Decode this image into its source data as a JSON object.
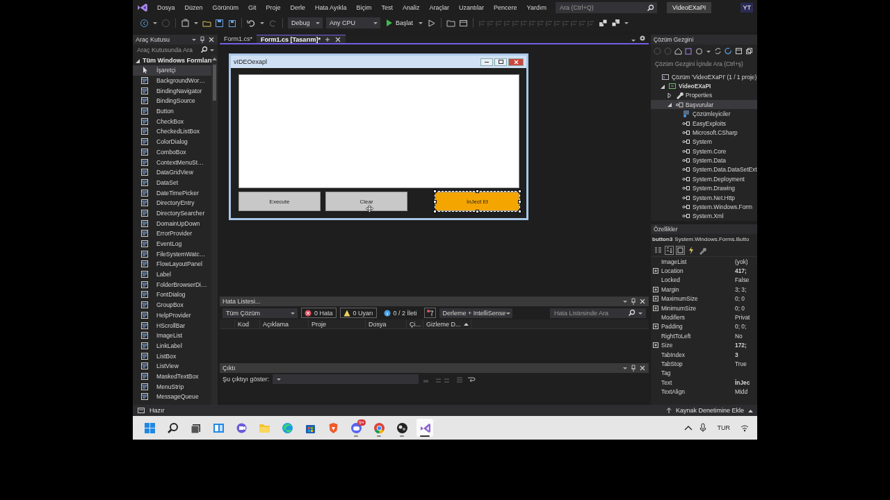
{
  "menu": {
    "items": [
      "Dosya",
      "Düzen",
      "Görünüm",
      "Git",
      "Proje",
      "Derle",
      "Hata Ayıkla",
      "Biçim",
      "Test",
      "Analiz",
      "Araçlar",
      "Uzantılar",
      "Pencere",
      "Yardım"
    ],
    "search_placeholder": "Ara (Ctrl+Q)",
    "project": "VideoEXaPI",
    "account": "YT"
  },
  "toolbar": {
    "configuration": "Debug",
    "platform": "Any CPU",
    "start": "Başlat"
  },
  "toolbox": {
    "title": "Araç Kutusu",
    "search_placeholder": "Araç Kutusunda Ara",
    "group": {
      "label": "Tüm Windows Formları",
      "expanded": true
    },
    "items": [
      {
        "label": "İşaretçi",
        "kind": "pointer",
        "selected": true
      },
      {
        "label": "BackgroundWor…",
        "kind": "control",
        "selected": false
      },
      {
        "label": "BindingNavigator",
        "kind": "control",
        "selected": false
      },
      {
        "label": "BindingSource",
        "kind": "control",
        "selected": false
      },
      {
        "label": "Button",
        "kind": "control",
        "selected": false
      },
      {
        "label": "CheckBox",
        "kind": "control",
        "selected": false
      },
      {
        "label": "CheckedListBox",
        "kind": "control",
        "selected": false
      },
      {
        "label": "ColorDialog",
        "kind": "control",
        "selected": false
      },
      {
        "label": "ComboBox",
        "kind": "control",
        "selected": false
      },
      {
        "label": "ContextMenuSt…",
        "kind": "control",
        "selected": false
      },
      {
        "label": "DataGridView",
        "kind": "control",
        "selected": false
      },
      {
        "label": "DataSet",
        "kind": "control",
        "selected": false
      },
      {
        "label": "DateTimePicker",
        "kind": "control",
        "selected": false
      },
      {
        "label": "DirectoryEntry",
        "kind": "control",
        "selected": false
      },
      {
        "label": "DirectorySearcher",
        "kind": "control",
        "selected": false
      },
      {
        "label": "DomainUpDown",
        "kind": "control",
        "selected": false
      },
      {
        "label": "ErrorProvider",
        "kind": "control",
        "selected": false
      },
      {
        "label": "EventLog",
        "kind": "control",
        "selected": false
      },
      {
        "label": "FileSystemWatc…",
        "kind": "control",
        "selected": false
      },
      {
        "label": "FlowLayoutPanel",
        "kind": "control",
        "selected": false
      },
      {
        "label": "Label",
        "kind": "control",
        "selected": false
      },
      {
        "label": "FolderBrowserDi…",
        "kind": "control",
        "selected": false
      },
      {
        "label": "FontDialog",
        "kind": "control",
        "selected": false
      },
      {
        "label": "GroupBox",
        "kind": "control",
        "selected": false
      },
      {
        "label": "HelpProvider",
        "kind": "control",
        "selected": false
      },
      {
        "label": "HScrollBar",
        "kind": "control",
        "selected": false
      },
      {
        "label": "ImageList",
        "kind": "control",
        "selected": false
      },
      {
        "label": "LinkLabel",
        "kind": "control",
        "selected": false
      },
      {
        "label": "ListBox",
        "kind": "control",
        "selected": false
      },
      {
        "label": "ListView",
        "kind": "control",
        "selected": false
      },
      {
        "label": "MaskedTextBox",
        "kind": "control",
        "selected": false
      },
      {
        "label": "MenuStrip",
        "kind": "control",
        "selected": false
      },
      {
        "label": "MessageQueue",
        "kind": "control",
        "selected": false
      }
    ]
  },
  "tabs": [
    {
      "label": "Form1.cs*",
      "selected": false
    },
    {
      "label": "Form1.cs [Tasarım]*",
      "selected": true
    }
  ],
  "form": {
    "title": "vIDEOexapl",
    "controls": [
      {
        "kind": "textbox",
        "selected": false
      },
      {
        "kind": "button",
        "text": "Execute",
        "color": "#c8c8c8",
        "selected": false
      },
      {
        "kind": "button",
        "text": "Clear",
        "color": "#c8c8c8",
        "selected": false
      },
      {
        "kind": "button",
        "text": "İnJect Et",
        "color": "#f5a500",
        "selected": true
      }
    ]
  },
  "error_list": {
    "title": "Hata Listesi...",
    "scope": "Tüm Çözüm",
    "errors": "0 Hata",
    "warnings": "0 Uyarı",
    "messages": "0 / 2 İleti",
    "build_filter": "Derleme + IntelliSense",
    "search_placeholder": "Hata Listesinde Ara",
    "columns": [
      {
        "label": "Kod",
        "sorted": false
      },
      {
        "label": "Açıklama",
        "sorted": false
      },
      {
        "label": "Proje",
        "sorted": false
      },
      {
        "label": "Dosya",
        "sorted": false
      },
      {
        "label": "Çi...",
        "sorted": false
      },
      {
        "label": "Gizleme D...",
        "sorted": true
      }
    ]
  },
  "output": {
    "title": "Çıktı",
    "show_label": "Şu çıktıyı göster:"
  },
  "solution": {
    "title": "Çözüm Gezgini",
    "search_placeholder": "Çözüm Gezgini İçinde Ara (Ctrl+ş)",
    "tree": [
      {
        "label": "Çözüm 'VideoEXaPI' (1 / 1 proje)",
        "kind": "solution",
        "selected": false,
        "children": [
          {
            "label": "VideoEXaPI",
            "kind": "project",
            "expanded": true,
            "selected": false,
            "children": [
              {
                "label": "Properties",
                "kind": "properties",
                "expanded": false,
                "selected": false
              },
              {
                "label": "Başvurular",
                "kind": "references",
                "expanded": true,
                "selected": true,
                "children": [
                  {
                    "label": "Çözümleyiciler",
                    "kind": "analyzers",
                    "selected": false
                  },
                  {
                    "label": "EasyExploits",
                    "kind": "reference",
                    "selected": false
                  },
                  {
                    "label": "Microsoft.CSharp",
                    "kind": "reference",
                    "selected": false
                  },
                  {
                    "label": "System",
                    "kind": "reference",
                    "selected": false
                  },
                  {
                    "label": "System.Core",
                    "kind": "reference",
                    "selected": false
                  },
                  {
                    "label": "System.Data",
                    "kind": "reference",
                    "selected": false
                  },
                  {
                    "label": "System.Data.DataSetExt",
                    "kind": "reference",
                    "selected": false
                  },
                  {
                    "label": "System.Deployment",
                    "kind": "reference",
                    "selected": false
                  },
                  {
                    "label": "System.Drawing",
                    "kind": "reference",
                    "selected": false
                  },
                  {
                    "label": "System.Net.Http",
                    "kind": "reference",
                    "selected": false
                  },
                  {
                    "label": "System.Windows.Form",
                    "kind": "reference",
                    "selected": false
                  },
                  {
                    "label": "System.Xml",
                    "kind": "reference",
                    "selected": false
                  }
                ]
              }
            ]
          }
        ]
      }
    ]
  },
  "properties": {
    "title": "Özellikler",
    "object": "button3",
    "type": "System.Windows.Forms.Butto",
    "rows": [
      {
        "name": "ImageList",
        "value": "(yok)",
        "expandable": false,
        "modified": false
      },
      {
        "name": "Location",
        "value": "417;",
        "expandable": true,
        "modified": true
      },
      {
        "name": "Locked",
        "value": "False",
        "expandable": false,
        "modified": false
      },
      {
        "name": "Margin",
        "value": "3; 3;",
        "expandable": true,
        "modified": false
      },
      {
        "name": "MaximumSize",
        "value": "0; 0",
        "expandable": true,
        "modified": false
      },
      {
        "name": "MinimumSize",
        "value": "0; 0",
        "expandable": true,
        "modified": false
      },
      {
        "name": "Modifiers",
        "value": "Privat",
        "expandable": false,
        "modified": false
      },
      {
        "name": "Padding",
        "value": "0; 0;",
        "expandable": true,
        "modified": false
      },
      {
        "name": "RightToLeft",
        "value": "No",
        "expandable": false,
        "modified": false
      },
      {
        "name": "Size",
        "value": "172;",
        "expandable": true,
        "modified": true
      },
      {
        "name": "TabIndex",
        "value": "3",
        "expandable": false,
        "modified": true
      },
      {
        "name": "TabStop",
        "value": "True",
        "expandable": false,
        "modified": false
      },
      {
        "name": "Tag",
        "expandable": false
      },
      {
        "name": "Text",
        "value": "İnJec",
        "expandable": false,
        "modified": true
      },
      {
        "name": "TextAlign",
        "value": "Midd",
        "expandable": false,
        "modified": false
      }
    ]
  },
  "status_bar": {
    "text": "Hazır",
    "source_control": "Kaynak Denetimine Ekle"
  },
  "taskbar": {
    "apps": [
      {
        "running": false,
        "active": false
      },
      {
        "running": false,
        "active": false
      },
      {
        "running": false,
        "active": false
      },
      {
        "running": false,
        "active": false
      },
      {
        "running": false,
        "active": false
      },
      {
        "running": false,
        "active": false
      },
      {
        "running": false,
        "active": false
      },
      {
        "running": false,
        "active": false
      },
      {
        "running": false,
        "active": false
      },
      {
        "running": true,
        "active": false,
        "badge": "9+"
      },
      {
        "running": true,
        "active": false
      },
      {
        "running": true,
        "active": false
      },
      {
        "running": true,
        "active": true
      }
    ],
    "language": "TUR"
  }
}
